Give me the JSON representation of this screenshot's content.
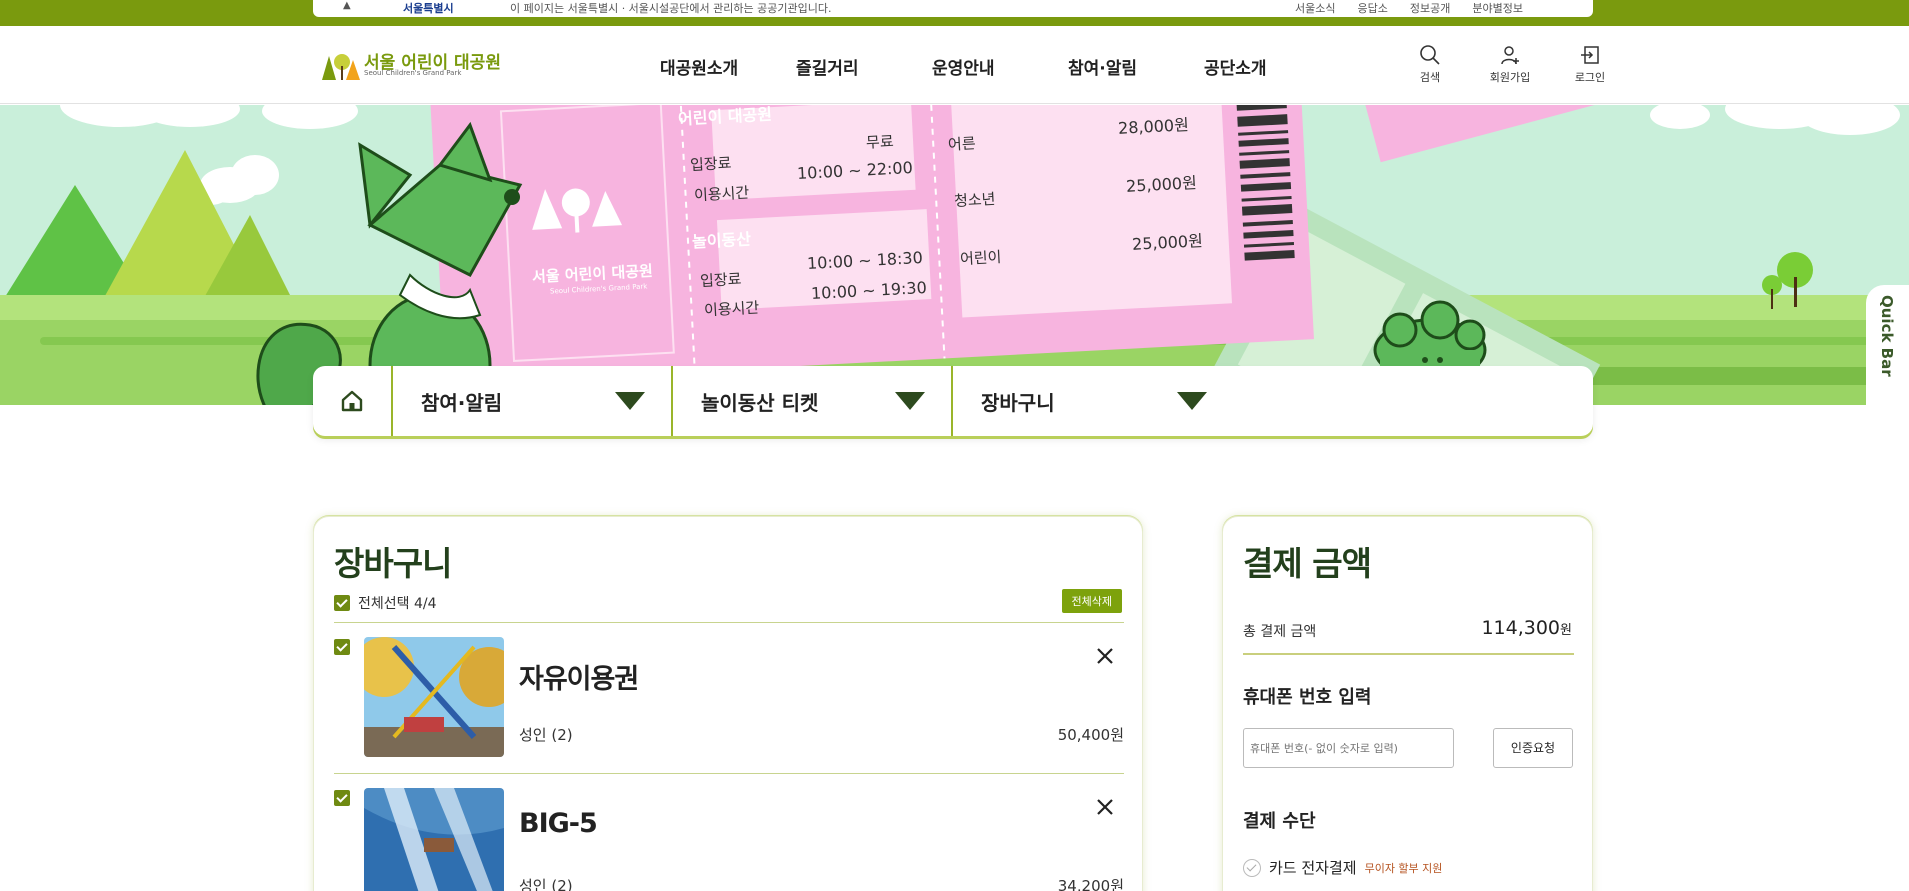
{
  "topbar": {
    "gov_label": "서울특별시",
    "seoul_label": "서울특별시",
    "notice": "이 페이지는 서울특별시 · 서울시설공단에서 관리하는 공공기관입니다.",
    "links": [
      "서울소식",
      "응답소",
      "정보공개",
      "분야별정보"
    ]
  },
  "header": {
    "logo_name": "서울 어린이 대공원",
    "logo_sub": "Seoul Children's Grand Park",
    "gnb": [
      "대공원소개",
      "즐길거리",
      "운영안내",
      "참여·알림",
      "공단소개"
    ],
    "util": [
      {
        "label": "검색",
        "icon": "search-icon"
      },
      {
        "label": "회원가입",
        "icon": "user-add-icon"
      },
      {
        "label": "로그인",
        "icon": "login-icon"
      }
    ]
  },
  "hero": {
    "ticket": {
      "park_name": "서울 어린이 대공원",
      "park_sub": "Seoul Children's Grand Park",
      "header": "어린이 대공원",
      "entry_label": "입장료",
      "entry_value": "무료",
      "hours_label": "이용시간",
      "hours_value": "10:00 ~ 22:00",
      "amusement_header": "놀이동산",
      "am_entry_label": "입장료",
      "am_entry_value": "10:00 ~ 18:30",
      "am_hours_label": "이용시간",
      "am_hours_value": "10:00 ~ 19:30",
      "prices": [
        {
          "label": "어른",
          "value": "28,000원"
        },
        {
          "label": "청소년",
          "value": "25,000원"
        },
        {
          "label": "어린이",
          "value": "25,000원"
        }
      ]
    },
    "quickbar": "Quick Bar"
  },
  "breadcrumb": {
    "items": [
      "참여·알림",
      "놀이동산 티켓",
      "장바구니"
    ]
  },
  "cart": {
    "title": "장바구니",
    "select_all": "전체선택 4/4",
    "delete_all": "전체삭제",
    "items": [
      {
        "title": "자유이용권",
        "option": "성인 (2)",
        "price": "50,400원"
      },
      {
        "title": "BIG-5",
        "option": "성인 (2)",
        "price": "34,200원"
      }
    ]
  },
  "payment": {
    "title": "결제 금액",
    "total_label": "총 결제 금액",
    "total_value": "114,300",
    "total_unit": "원",
    "phone_heading": "휴대폰 번호 입력",
    "phone_placeholder": "휴대폰 번호(- 없이 숫자로 입력)",
    "auth_button": "인증요청",
    "method_heading": "결제 수단",
    "method_card": "카드 전자결제",
    "method_note": "무이자 할부 지원"
  },
  "colors": {
    "brand_green": "#7a9a0e",
    "dark_green": "#23401c",
    "ticket_pink": "#f7b4df",
    "ticket_mint": "#b9e3bd"
  }
}
